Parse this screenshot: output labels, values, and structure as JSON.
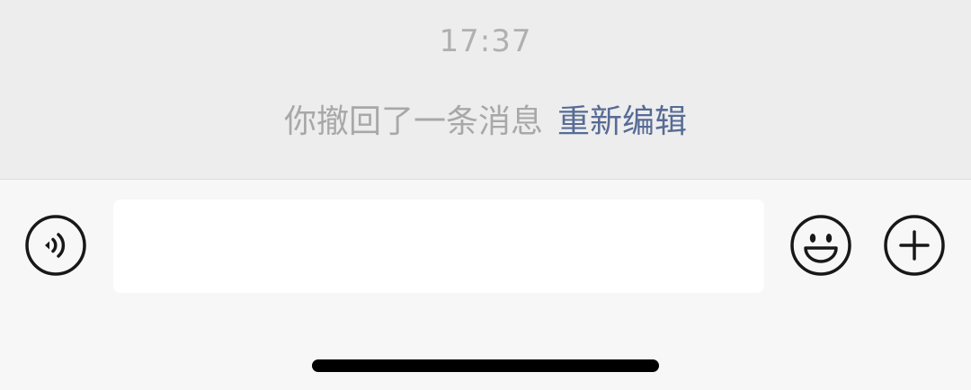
{
  "chat": {
    "timestamp": "17:37",
    "recall_notice": "你撤回了一条消息",
    "reedit_label": "重新编辑"
  },
  "input_bar": {
    "message_value": "",
    "voice_icon": "voice-icon",
    "emoji_icon": "emoji-icon",
    "more_icon": "plus-icon"
  },
  "colors": {
    "chat_background": "#ededed",
    "input_bar_background": "#f7f7f7",
    "link": "#576b95",
    "system_text": "#a8a8a8"
  }
}
